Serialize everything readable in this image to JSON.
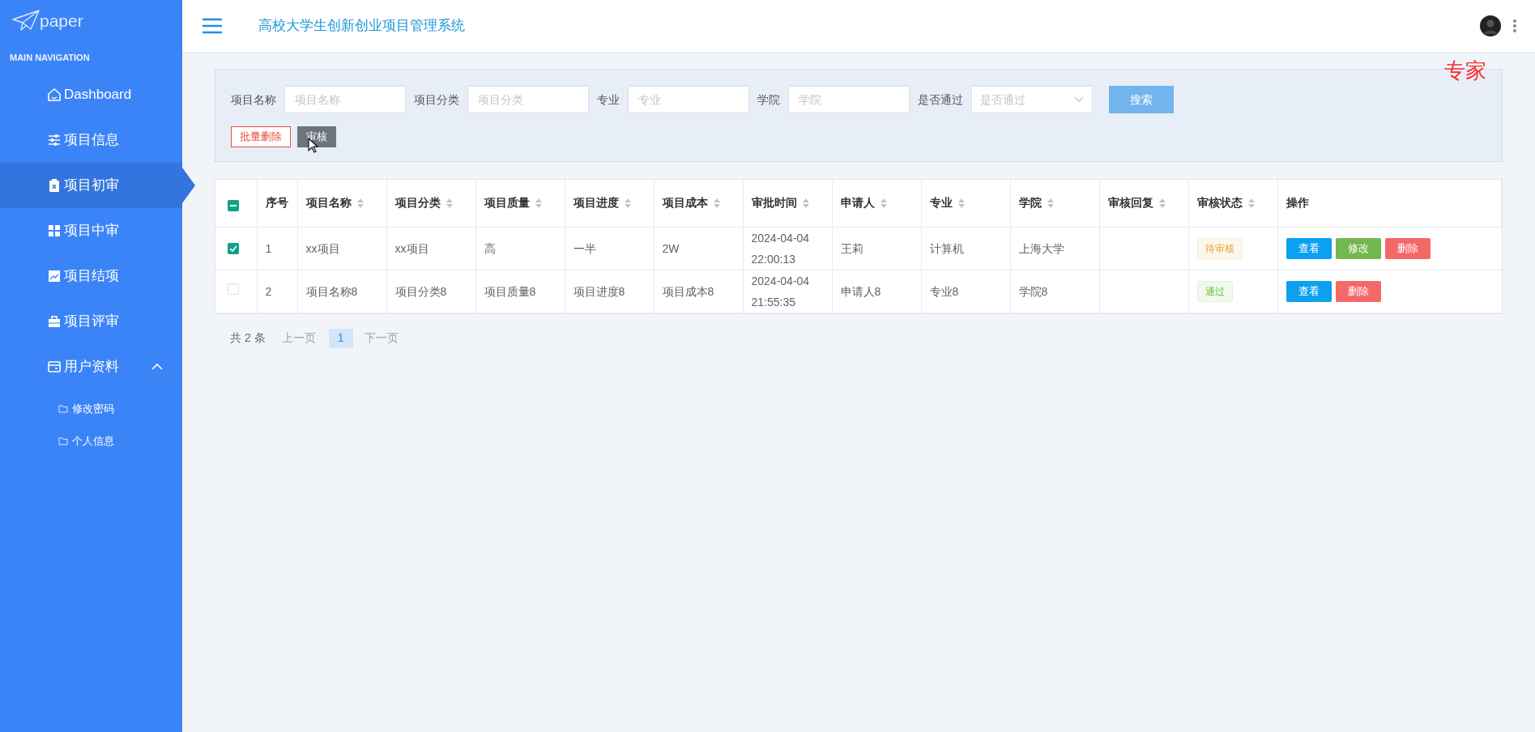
{
  "sidebar": {
    "logo": "paper",
    "section": "MAIN NAVIGATION",
    "items": [
      {
        "kind": "home",
        "label": "Dashboard",
        "selected": false
      },
      {
        "kind": "sliders",
        "label": "项目信息",
        "selected": false
      },
      {
        "kind": "clipboard",
        "label": "项目初审",
        "selected": true
      },
      {
        "kind": "grid",
        "label": "项目中审",
        "selected": false
      },
      {
        "kind": "chart",
        "label": "项目结项",
        "selected": false
      },
      {
        "kind": "briefcase",
        "label": "项目评审",
        "selected": false
      },
      {
        "kind": "card",
        "label": "用户资料",
        "selected": false,
        "expanded": true,
        "children": [
          {
            "label": "修改密码",
            "selected": false
          },
          {
            "label": "个人信息",
            "selected": false
          }
        ]
      }
    ]
  },
  "header": {
    "title": "高校大学生创新创业项目管理系统"
  },
  "role_label": "专家",
  "search": {
    "fields": [
      {
        "kind": "input",
        "label": "项目名称",
        "placeholder": "项目名称"
      },
      {
        "kind": "input",
        "label": "项目分类",
        "placeholder": "项目分类"
      },
      {
        "kind": "input",
        "label": "专业",
        "placeholder": "专业"
      },
      {
        "kind": "input",
        "label": "学院",
        "placeholder": "学院"
      },
      {
        "kind": "select",
        "label": "是否通过",
        "placeholder": "是否通过"
      }
    ],
    "search_button": "搜索",
    "actions": [
      {
        "kind": "danger",
        "label": "批量删除"
      },
      {
        "kind": "dark",
        "label": "审核"
      }
    ]
  },
  "table": {
    "select_all": {
      "indeterminate": true
    },
    "columns": [
      {
        "label": "序号",
        "sortable": false
      },
      {
        "label": "项目名称",
        "sortable": true
      },
      {
        "label": "项目分类",
        "sortable": true
      },
      {
        "label": "项目质量",
        "sortable": true
      },
      {
        "label": "项目进度",
        "sortable": true
      },
      {
        "label": "项目成本",
        "sortable": true
      },
      {
        "label": "审批时间",
        "sortable": true
      },
      {
        "label": "申请人",
        "sortable": true
      },
      {
        "label": "专业",
        "sortable": true
      },
      {
        "label": "学院",
        "sortable": true
      },
      {
        "label": "审核回复",
        "sortable": true
      },
      {
        "label": "审核状态",
        "sortable": true
      },
      {
        "label": "操作",
        "sortable": false
      }
    ],
    "rows": [
      {
        "checked": true,
        "cells": [
          "1",
          "xx项目",
          "xx项目",
          "高",
          "一半",
          "2W",
          "2024-04-04 22:00:13",
          "王莉",
          "计算机",
          "上海大学",
          ""
        ],
        "status": {
          "kind": "pending",
          "label": "待审核"
        },
        "actions": [
          {
            "kind": "view",
            "label": "查看"
          },
          {
            "kind": "edit",
            "label": "修改"
          },
          {
            "kind": "delete",
            "label": "删除"
          }
        ]
      },
      {
        "checked": false,
        "cells": [
          "2",
          "项目名称8",
          "项目分类8",
          "项目质量8",
          "项目进度8",
          "项目成本8",
          "2024-04-04 21:55:35",
          "申请人8",
          "专业8",
          "学院8",
          ""
        ],
        "status": {
          "kind": "passed",
          "label": "通过"
        },
        "actions": [
          {
            "kind": "view",
            "label": "查看"
          },
          {
            "kind": "delete",
            "label": "删除"
          }
        ]
      }
    ]
  },
  "pagination": {
    "total": "共 2 条",
    "prev": "上一页",
    "pages": [
      {
        "label": "1",
        "selected": true
      }
    ],
    "next": "下一页"
  }
}
